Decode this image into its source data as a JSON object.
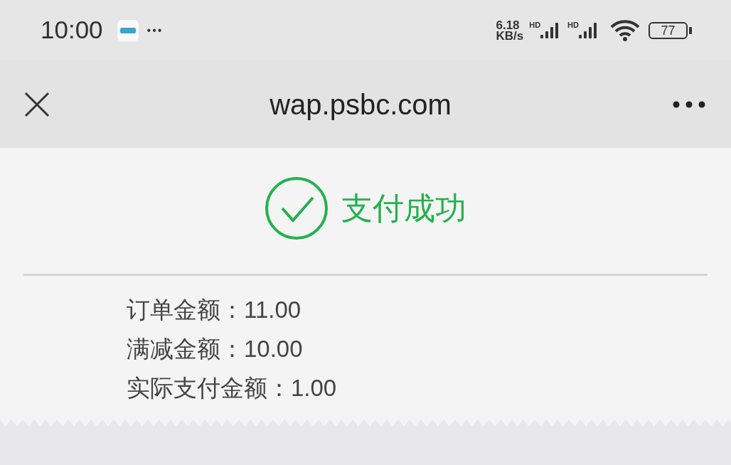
{
  "status_bar": {
    "time": "10:00",
    "more": "•••",
    "speed_value": "6.18",
    "speed_unit": "KB/s",
    "signals": [
      {
        "label": "HD"
      },
      {
        "label": "HD"
      }
    ],
    "battery": "77"
  },
  "nav_bar": {
    "title": "wap.psbc.com"
  },
  "result": {
    "title": "支付成功"
  },
  "details": [
    {
      "text": "订单金额：11.00"
    },
    {
      "text": "满减金额：10.00"
    },
    {
      "text": "实际支付金额：1.00"
    }
  ]
}
